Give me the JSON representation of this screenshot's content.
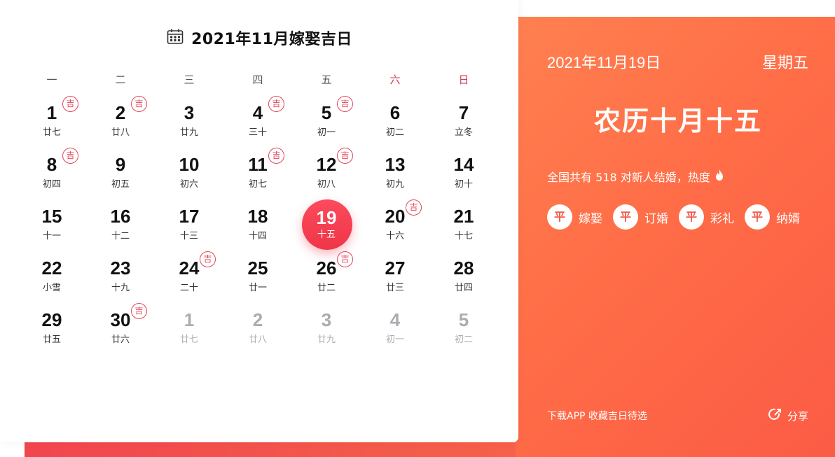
{
  "calendar": {
    "title": "2021年11月嫁娶吉日",
    "weekdays": [
      "一",
      "二",
      "三",
      "四",
      "五",
      "六",
      "日"
    ],
    "ji_label": "吉",
    "days": [
      {
        "num": "1",
        "lunar": "廿七",
        "ji": true
      },
      {
        "num": "2",
        "lunar": "廿八",
        "ji": true
      },
      {
        "num": "3",
        "lunar": "廿九",
        "ji": false
      },
      {
        "num": "4",
        "lunar": "三十",
        "ji": true
      },
      {
        "num": "5",
        "lunar": "初一",
        "ji": true
      },
      {
        "num": "6",
        "lunar": "初二",
        "ji": false
      },
      {
        "num": "7",
        "lunar": "立冬",
        "ji": false
      },
      {
        "num": "8",
        "lunar": "初四",
        "ji": true
      },
      {
        "num": "9",
        "lunar": "初五",
        "ji": false
      },
      {
        "num": "10",
        "lunar": "初六",
        "ji": false
      },
      {
        "num": "11",
        "lunar": "初七",
        "ji": true
      },
      {
        "num": "12",
        "lunar": "初八",
        "ji": true
      },
      {
        "num": "13",
        "lunar": "初九",
        "ji": false
      },
      {
        "num": "14",
        "lunar": "初十",
        "ji": false
      },
      {
        "num": "15",
        "lunar": "十一",
        "ji": false
      },
      {
        "num": "16",
        "lunar": "十二",
        "ji": false
      },
      {
        "num": "17",
        "lunar": "十三",
        "ji": false
      },
      {
        "num": "18",
        "lunar": "十四",
        "ji": false
      },
      {
        "num": "19",
        "lunar": "十五",
        "ji": false,
        "selected": true
      },
      {
        "num": "20",
        "lunar": "十六",
        "ji": true
      },
      {
        "num": "21",
        "lunar": "十七",
        "ji": false
      },
      {
        "num": "22",
        "lunar": "小雪",
        "ji": false
      },
      {
        "num": "23",
        "lunar": "十九",
        "ji": false
      },
      {
        "num": "24",
        "lunar": "二十",
        "ji": true
      },
      {
        "num": "25",
        "lunar": "廿一",
        "ji": false
      },
      {
        "num": "26",
        "lunar": "廿二",
        "ji": true
      },
      {
        "num": "27",
        "lunar": "廿三",
        "ji": false
      },
      {
        "num": "28",
        "lunar": "廿四",
        "ji": false
      },
      {
        "num": "29",
        "lunar": "廿五",
        "ji": false
      },
      {
        "num": "30",
        "lunar": "廿六",
        "ji": true
      },
      {
        "num": "1",
        "lunar": "廿七",
        "ji": false,
        "other": true
      },
      {
        "num": "2",
        "lunar": "廿八",
        "ji": false,
        "other": true
      },
      {
        "num": "3",
        "lunar": "廿九",
        "ji": false,
        "other": true
      },
      {
        "num": "4",
        "lunar": "初一",
        "ji": false,
        "other": true
      },
      {
        "num": "5",
        "lunar": "初二",
        "ji": false,
        "other": true
      }
    ]
  },
  "detail": {
    "date": "2021年11月19日",
    "weekday": "星期五",
    "lunar": "农历十月十五",
    "stat": "全国共有 518 对新人结婚，热度",
    "tags": [
      {
        "badge": "平",
        "label": "嫁娶"
      },
      {
        "badge": "平",
        "label": "订婚"
      },
      {
        "badge": "平",
        "label": "彩礼"
      },
      {
        "badge": "平",
        "label": "纳婿"
      }
    ],
    "download": "下载APP 收藏吉日待选",
    "share": "分享"
  },
  "icons": {
    "calendar": "calendar-icon",
    "flame": "flame-icon",
    "share": "share-icon"
  },
  "colors": {
    "accent": "#f03548",
    "panel": "#ff7049",
    "ji": "#e0485a"
  }
}
